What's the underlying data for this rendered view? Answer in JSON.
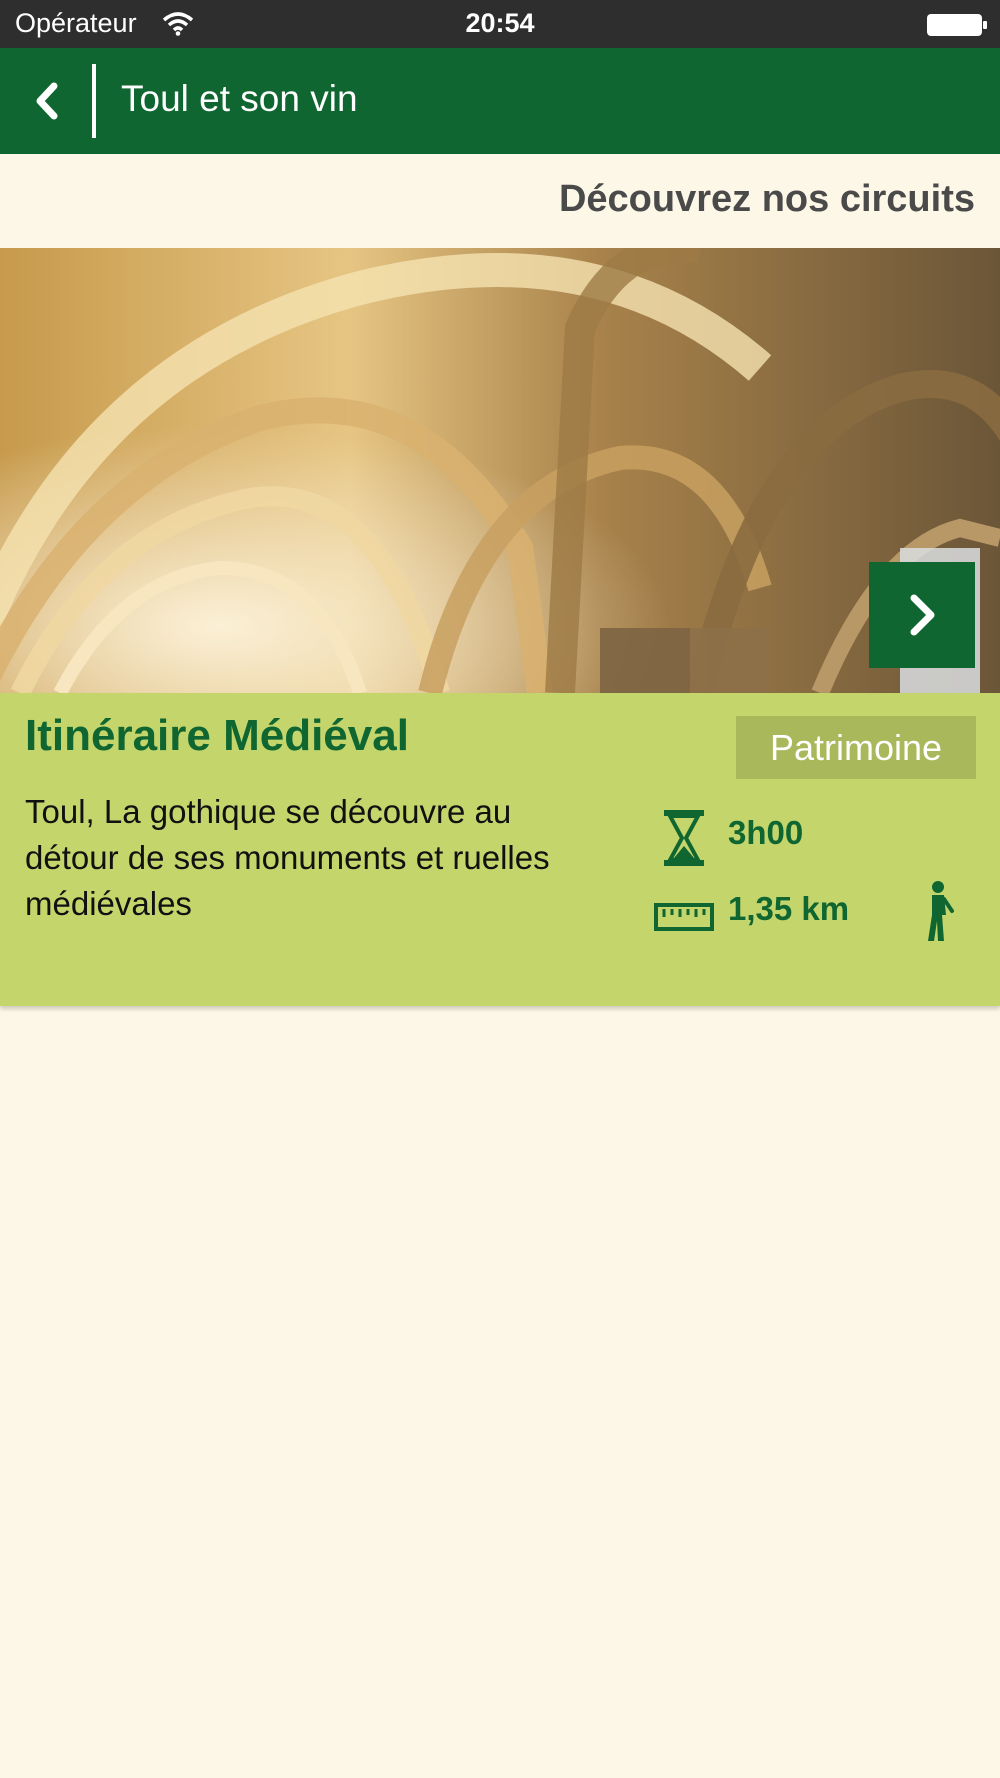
{
  "status_bar": {
    "carrier": "Opérateur",
    "time": "20:54"
  },
  "nav": {
    "title": "Toul et son vin",
    "back_icon": "chevron-left-icon"
  },
  "section": {
    "title": "Découvrez nos circuits"
  },
  "circuit": {
    "title": "Itinéraire Médiéval",
    "category": "Patrimoine",
    "description": "Toul, La gothique se découvre au détour de ses monuments et ruelles médiévales",
    "duration": "3h00",
    "distance": "1,35 km",
    "icons": {
      "duration": "hourglass-icon",
      "distance": "ruler-icon",
      "mode": "walker-icon",
      "next": "chevron-right-icon"
    }
  },
  "colors": {
    "primary_green": "#0f6630",
    "card_green": "#c4d56c",
    "badge_green": "#a8b85a",
    "background": "#fdf7e7"
  }
}
